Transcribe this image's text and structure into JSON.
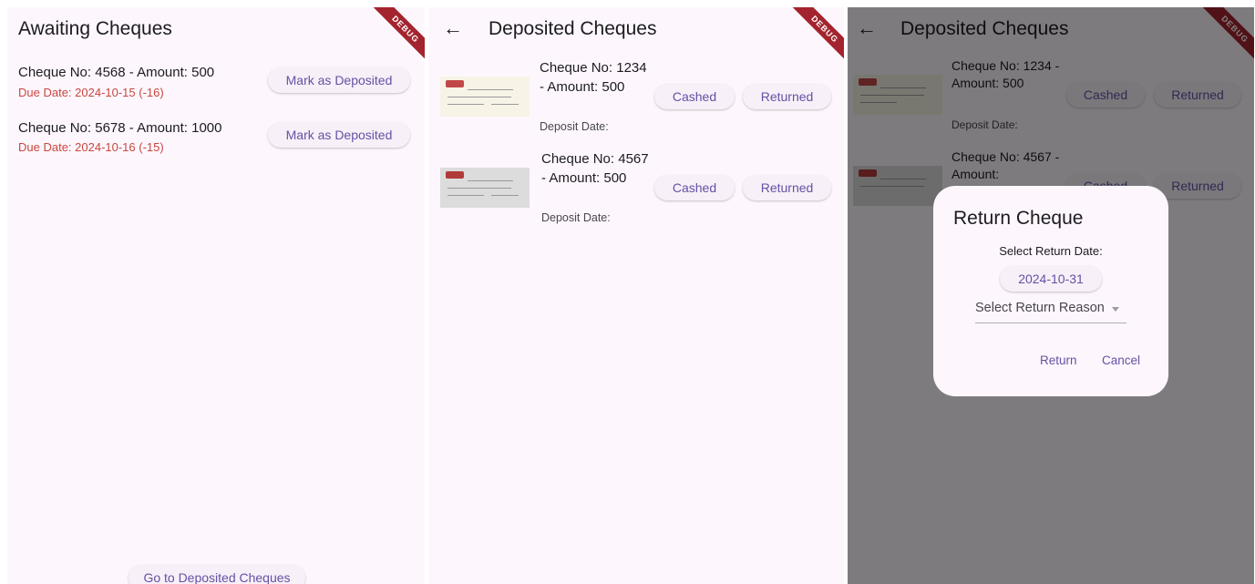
{
  "colors": {
    "background": "#fdf7fd",
    "accent": "#6750a4",
    "due_red": "#c9463e",
    "debug_banner": "#a3242e"
  },
  "debug_label": "DEBUG",
  "screen1": {
    "title": "Awaiting Cheques",
    "items": [
      {
        "label": "Cheque No: 4568 - Amount: 500",
        "due": "Due Date: 2024-10-15 (-16)",
        "button": "Mark as Deposited"
      },
      {
        "label": "Cheque No: 5678 - Amount: 1000",
        "due": "Due Date: 2024-10-16 (-15)",
        "button": "Mark as Deposited"
      }
    ],
    "footer_button": "Go to Deposited Cheques"
  },
  "screen2": {
    "back_icon": "arrow-left-icon",
    "title": "Deposited Cheques",
    "items": [
      {
        "label": "Cheque No: 1234 - Amount: 500",
        "deposit": "Deposit Date:",
        "cashed": "Cashed",
        "returned": "Returned"
      },
      {
        "label": "Cheque No: 4567 - Amount: 500",
        "deposit": "Deposit Date:",
        "cashed": "Cashed",
        "returned": "Returned"
      }
    ]
  },
  "screen3": {
    "back_icon": "arrow-left-icon",
    "title": "Deposited Cheques",
    "items": [
      {
        "label": "Cheque No: 1234 - Amount: 500",
        "deposit": "Deposit Date:",
        "cashed": "Cashed",
        "returned": "Returned"
      },
      {
        "label_partial": "Cheque No: 4567 - Amount:",
        "cashed_partial": "Cashed",
        "returned": "Returned"
      }
    ],
    "dialog": {
      "title": "Return Cheque",
      "date_label": "Select Return Date:",
      "date_value": "2024-10-31",
      "reason_placeholder": "Select Return Reason",
      "return_button": "Return",
      "cancel_button": "Cancel"
    }
  }
}
